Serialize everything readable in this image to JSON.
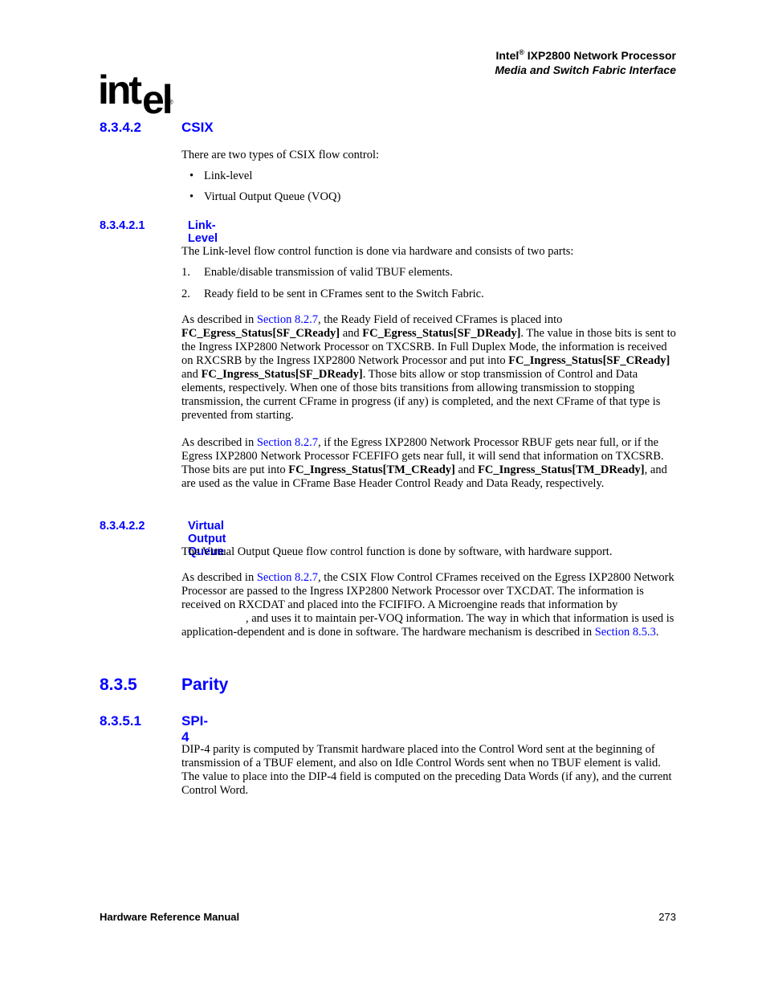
{
  "header": {
    "brand": "Intel",
    "reg": "®",
    "product": " IXP2800 Network Processor",
    "subtitle": "Media and Switch Fabric Interface"
  },
  "logo": {
    "letters": "int",
    "el": "el",
    "reg": "®"
  },
  "sections": {
    "s8342": {
      "num": "8.3.4.2",
      "title": "CSIX"
    },
    "s83421": {
      "num": "8.3.4.2.1",
      "title": "Link-Level"
    },
    "s83422": {
      "num": "8.3.4.2.2",
      "title": "Virtual Output Queue"
    },
    "s835": {
      "num": "8.3.5",
      "title": "Parity"
    },
    "s8351": {
      "num": "8.3.5.1",
      "title": "SPI-4"
    }
  },
  "csix": {
    "intro": "There are two types of CSIX flow control:",
    "bullets": [
      "Link-level",
      "Virtual Output Queue (VOQ)"
    ]
  },
  "link_level": {
    "intro": "The Link-level flow control function is done via hardware and consists of two parts:",
    "steps": [
      {
        "n": "1.",
        "text": "Enable/disable transmission of valid TBUF elements."
      },
      {
        "n": "2.",
        "text": "Ready field to be sent in CFrames sent to the Switch Fabric."
      }
    ],
    "p1": {
      "a": "As described in ",
      "link": "Section 8.2.7",
      "b": ", the Ready Field of received CFrames is placed into ",
      "bold1": "FC_Egress_Status[SF_CReady]",
      "c": " and ",
      "bold2": "FC_Egress_Status[SF_DReady]",
      "d": ". The value in those bits is sent to the Ingress IXP2800 Network Processor on TXCSRB. In Full Duplex Mode, the information is received on RXCSRB by the Ingress IXP2800 Network Processor and put into ",
      "bold3": "FC_Ingress_Status[SF_CReady]",
      "e": " and ",
      "bold4": "FC_Ingress_Status[SF_DReady]",
      "f": ". Those bits allow or stop transmission of Control and Data elements, respectively. When one of those bits transitions from allowing transmission to stopping transmission, the current CFrame in progress (if any) is completed, and the next CFrame of that type is prevented from starting."
    },
    "p2": {
      "a": "As described in ",
      "link": "Section 8.2.7",
      "b": ", if the Egress IXP2800 Network Processor RBUF gets near full, or if the Egress IXP2800 Network Processor FCEFIFO gets near full, it will send that information on TXCSRB. Those bits are put into ",
      "bold1": "FC_Ingress_Status[TM_CReady]",
      "c": " and ",
      "bold2": "FC_Ingress_Status[TM_DReady]",
      "d": ", and are used as the value in CFrame Base Header Control Ready and Data Ready, respectively."
    }
  },
  "voq": {
    "intro": "The Virtual Output Queue flow control function is done by software, with hardware support.",
    "p1": {
      "a": "As described in ",
      "link1": "Section 8.2.7",
      "b": ", the CSIX Flow Control CFrames received on the Egress IXP2800 Network Processor are passed to the Ingress IXP2800 Network Processor over TXCDAT. The information is received on RXCDAT and placed into the FCIFIFO. A Microengine reads that information by",
      "c": ", and uses it to maintain per-VOQ information. The way in which that information is used is application-dependent and is done in software. The hardware mechanism is described in ",
      "link2": "Section 8.5.3",
      "d": "."
    }
  },
  "spi4": {
    "p1": "DIP-4 parity is computed by Transmit hardware placed into the Control Word sent at the beginning of transmission of a TBUF element, and also on Idle Control Words sent when no TBUF element is valid. The value to place into the DIP-4 field is computed on the preceding Data Words (if any), and the current Control Word."
  },
  "footer": {
    "left": "Hardware Reference Manual",
    "page": "273"
  },
  "colors": {
    "heading": "#0000ff",
    "link": "#0000ff",
    "text": "#000000"
  }
}
